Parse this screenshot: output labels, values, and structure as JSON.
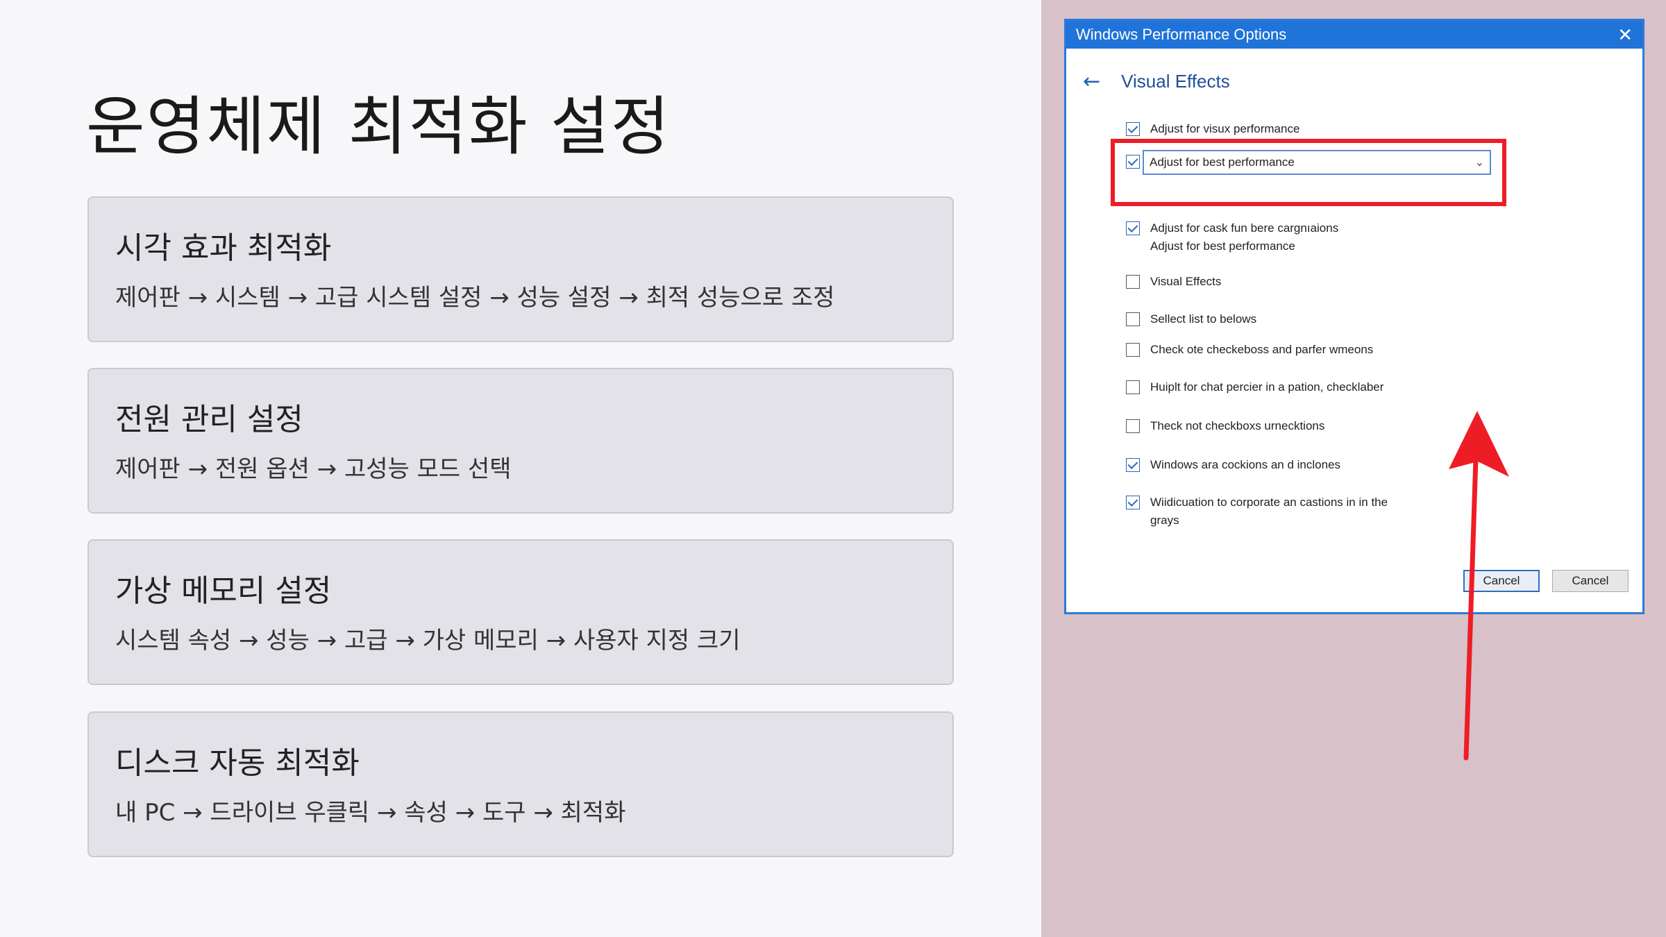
{
  "slide": {
    "title": "운영체제 최적화 설정",
    "cards": [
      {
        "title": "시각 효과 최적화",
        "desc": "제어판 → 시스템 → 고급 시스템 설정 → 성능 설정 → 최적 성능으로 조정"
      },
      {
        "title": "전원 관리 설정",
        "desc": "제어판 → 전원 옵션 → 고성능 모드 선택"
      },
      {
        "title": "가상 메모리 설정",
        "desc": "시스템 속성 → 성능 → 고급 → 가상 메모리 → 사용자 지정 크기"
      },
      {
        "title": "디스크 자동 최적화",
        "desc": "내 PC → 드라이브 우클릭 → 속성 → 도구 → 최적화"
      }
    ]
  },
  "dialog": {
    "window_title": "Windows Performance Options",
    "close_glyph": "✕",
    "back_glyph": "←",
    "section_title": "Visual Effects",
    "select_value": "Adjust for best performance",
    "select_chevron": "⌄",
    "options": [
      {
        "label": "Adjust for visux performance",
        "checked": true
      },
      {
        "label": "Adjust for cask fun bere cargnıaions",
        "label2": "Adjust for best performance",
        "checked": true
      },
      {
        "label": "Visual Effects",
        "checked": false
      },
      {
        "label": "Sellect list to belows",
        "checked": false
      },
      {
        "label": "Check ote checkeboss and parfer wmeons",
        "checked": false
      },
      {
        "label": "Huiplt for chat percier in a pation, checklaber",
        "checked": false
      },
      {
        "label": "Theck not checkboxs urnecktions",
        "checked": false
      },
      {
        "label": "Windows ara cockions an d inclones",
        "checked": true
      },
      {
        "label": "Wiidicuation to corporate an castions in in the",
        "label2": "grays",
        "checked": true
      }
    ],
    "select_checked": true,
    "buttons": {
      "primary": "Cancel",
      "secondary": "Cancel"
    }
  },
  "colors": {
    "accent": "#1f73d9",
    "highlight": "#ee1d25",
    "right_bg": "#d9c1c9"
  }
}
